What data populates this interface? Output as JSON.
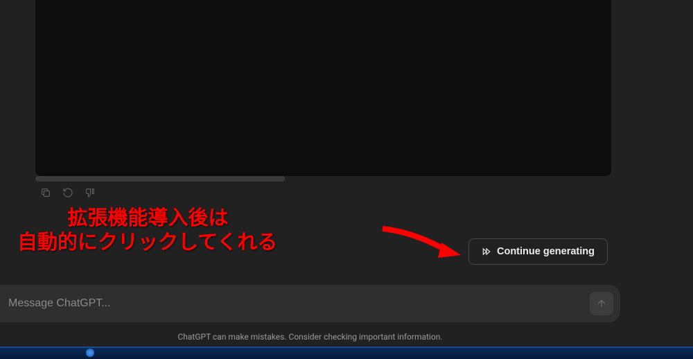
{
  "actions": {
    "copy": "copy-icon",
    "regenerate": "regenerate-icon",
    "dislike": "dislike-icon"
  },
  "annotation": {
    "line1": "         拡張機能導入後は",
    "line2": "自動的にクリックしてくれる"
  },
  "continue_button": {
    "label": "Continue generating"
  },
  "input": {
    "placeholder": "Message ChatGPT..."
  },
  "footer": {
    "text": "ChatGPT can make mistakes. Consider checking important information."
  }
}
